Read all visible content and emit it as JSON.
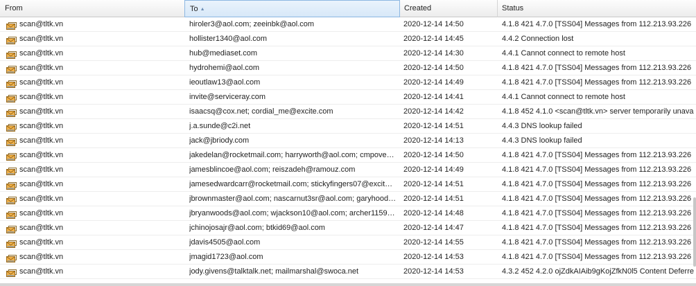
{
  "columns": [
    {
      "label": "From"
    },
    {
      "label": "To",
      "sorted": "asc"
    },
    {
      "label": "Created"
    },
    {
      "label": "Status"
    }
  ],
  "sort_indicator": "▲",
  "icons": {
    "row_icon": "mail-queue-icon"
  },
  "rows": [
    {
      "from": "scan@tltk.vn",
      "to": "hiroler3@aol.com; zeeinbk@aol.com",
      "created": "2020-12-14 14:50",
      "status": "4.1.8 421 4.7.0 [TSS04] Messages from 112.213.93.226"
    },
    {
      "from": "scan@tltk.vn",
      "to": "hollister1340@aol.com",
      "created": "2020-12-14 14:45",
      "status": "4.4.2 Connection lost"
    },
    {
      "from": "scan@tltk.vn",
      "to": "hub@mediaset.com",
      "created": "2020-12-14 14:30",
      "status": "4.4.1 Cannot connect to remote host"
    },
    {
      "from": "scan@tltk.vn",
      "to": "hydrohemi@aol.com",
      "created": "2020-12-14 14:50",
      "status": "4.1.8 421 4.7.0 [TSS04] Messages from 112.213.93.226"
    },
    {
      "from": "scan@tltk.vn",
      "to": "ieoutlaw13@aol.com",
      "created": "2020-12-14 14:49",
      "status": "4.1.8 421 4.7.0 [TSS04] Messages from 112.213.93.226"
    },
    {
      "from": "scan@tltk.vn",
      "to": "invite@serviceray.com",
      "created": "2020-12-14 14:41",
      "status": "4.4.1 Cannot connect to remote host"
    },
    {
      "from": "scan@tltk.vn",
      "to": "isaacsq@cox.net; cordial_me@excite.com",
      "created": "2020-12-14 14:42",
      "status": "4.1.8 452 4.1.0 <scan@tltk.vn> server temporarily unava"
    },
    {
      "from": "scan@tltk.vn",
      "to": "j.a.sunde@c2i.net",
      "created": "2020-12-14 14:51",
      "status": "4.4.3 DNS lookup failed"
    },
    {
      "from": "scan@tltk.vn",
      "to": "jack@jbriody.com",
      "created": "2020-12-14 14:13",
      "status": "4.4.3 DNS lookup failed"
    },
    {
      "from": "scan@tltk.vn",
      "to": "jakedelan@rocketmail.com; harryworth@aol.com; cmpove…",
      "created": "2020-12-14 14:50",
      "status": "4.1.8 421 4.7.0 [TSS04] Messages from 112.213.93.226"
    },
    {
      "from": "scan@tltk.vn",
      "to": "jamesblincoe@aol.com; reiszadeh@ramouz.com",
      "created": "2020-12-14 14:49",
      "status": "4.1.8 421 4.7.0 [TSS04] Messages from 112.213.93.226"
    },
    {
      "from": "scan@tltk.vn",
      "to": "jamesedwardcarr@rocketmail.com; stickyfingers07@excit…",
      "created": "2020-12-14 14:51",
      "status": "4.1.8 421 4.7.0 [TSS04] Messages from 112.213.93.226"
    },
    {
      "from": "scan@tltk.vn",
      "to": "jbrownmaster@aol.com; nascarnut3sr@aol.com; garyhood…",
      "created": "2020-12-14 14:51",
      "status": "4.1.8 421 4.7.0 [TSS04] Messages from 112.213.93.226"
    },
    {
      "from": "scan@tltk.vn",
      "to": "jbryanwoods@aol.com; wjackson10@aol.com; archer1159…",
      "created": "2020-12-14 14:48",
      "status": "4.1.8 421 4.7.0 [TSS04] Messages from 112.213.93.226"
    },
    {
      "from": "scan@tltk.vn",
      "to": "jchinojosajr@aol.com; btkid69@aol.com",
      "created": "2020-12-14 14:47",
      "status": "4.1.8 421 4.7.0 [TSS04] Messages from 112.213.93.226"
    },
    {
      "from": "scan@tltk.vn",
      "to": "jdavis4505@aol.com",
      "created": "2020-12-14 14:55",
      "status": "4.1.8 421 4.7.0 [TSS04] Messages from 112.213.93.226"
    },
    {
      "from": "scan@tltk.vn",
      "to": "jmagid1723@aol.com",
      "created": "2020-12-14 14:53",
      "status": "4.1.8 421 4.7.0 [TSS04] Messages from 112.213.93.226"
    },
    {
      "from": "scan@tltk.vn",
      "to": "jody.givens@talktalk.net; mailmarshal@swoca.net",
      "created": "2020-12-14 14:53",
      "status": "4.3.2 452 4.2.0 ojZdkAIAib9gKojZfkN0l5 Content Deferre"
    }
  ]
}
